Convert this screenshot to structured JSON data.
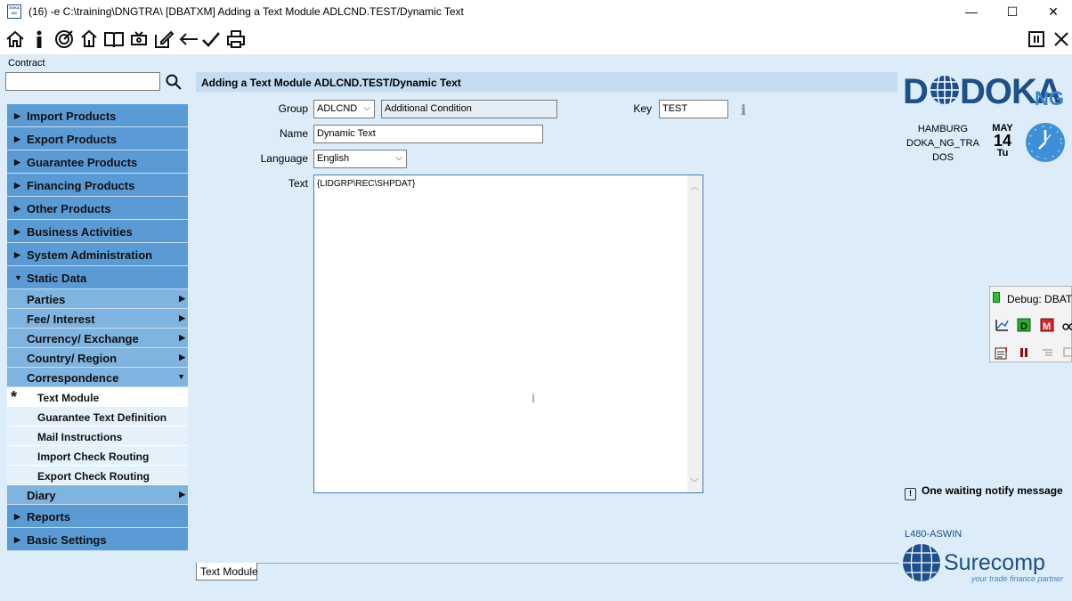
{
  "window": {
    "title": "(16) -e C:\\training\\DNGTRA\\  [DBATXM] Adding a Text Module ADLCND.TEST/Dynamic Text",
    "app_icon_text": "DOKA NG",
    "minimize": "—",
    "maximize": "☐",
    "close": "✕"
  },
  "toolbar": {
    "icons": [
      "home-icon",
      "info-icon",
      "target-icon",
      "tree-icon",
      "book-icon",
      "refresh-icon",
      "edit-icon",
      "back-arrow-icon",
      "checkmark-icon",
      "print-icon"
    ],
    "right_icons": [
      "panel-toggle-icon",
      "close-icon"
    ]
  },
  "contract": {
    "label": "Contract",
    "value": "",
    "placeholder": ""
  },
  "nav": {
    "main_top": [
      {
        "label": "Import Products",
        "expanded": false
      },
      {
        "label": "Export Products",
        "expanded": false
      },
      {
        "label": "Guarantee Products",
        "expanded": false
      },
      {
        "label": "Financing Products",
        "expanded": false
      },
      {
        "label": "Other Products",
        "expanded": false
      },
      {
        "label": "Business Activities",
        "expanded": false
      },
      {
        "label": "System Administration",
        "expanded": false
      },
      {
        "label": "Static Data",
        "expanded": true
      }
    ],
    "static_sub": [
      {
        "label": "Parties"
      },
      {
        "label": "Fee/ Interest"
      },
      {
        "label": "Currency/ Exchange"
      },
      {
        "label": "Country/ Region"
      },
      {
        "label": "Correspondence"
      }
    ],
    "correspondence_items": [
      {
        "label": "Text Module",
        "active": true
      },
      {
        "label": "Guarantee Text Definition",
        "active": false
      },
      {
        "label": "Mail Instructions",
        "active": false
      },
      {
        "label": "Import Check Routing",
        "active": false
      },
      {
        "label": "Export Check Routing",
        "active": false
      }
    ],
    "diary": {
      "label": "Diary"
    },
    "main_bottom": [
      {
        "label": "Reports"
      },
      {
        "label": "Basic Settings"
      }
    ]
  },
  "form": {
    "header": "Adding a Text Module ADLCND.TEST/Dynamic Text",
    "group_label": "Group",
    "group_value": "ADLCND",
    "group_desc": "Additional Condition",
    "key_label": "Key",
    "key_value": "TEST",
    "name_label": "Name",
    "name_value": "Dynamic Text",
    "language_label": "Language",
    "language_value": "English",
    "text_label": "Text",
    "text_value": "{LIDGRP\\REC\\SHPDAT}"
  },
  "bottom_tab": {
    "label": "Text Module"
  },
  "right_panel": {
    "logo_text": "DOKA",
    "logo_suffix": "NG",
    "location_lines": [
      "HAMBURG",
      "DOKA_NG_TRA",
      "DOS"
    ],
    "date_month": "MAY",
    "date_day": "14",
    "date_weekday": "Tu",
    "debug_title": "Debug: DBATX",
    "notify_text": "One waiting notify message",
    "host": "L480-ASWIN",
    "surecomp_name": "Surecomp",
    "surecomp_tagline": "your trade finance partner"
  },
  "colors": {
    "background": "#dcecf8",
    "nav_main": "#5b9bd5",
    "nav_sub": "#7fb3e0",
    "nav_item": "#e4f0fa",
    "header": "#c4dcf1",
    "brand_blue": "#1d4f8a",
    "text_border": "#3c7fc1"
  }
}
